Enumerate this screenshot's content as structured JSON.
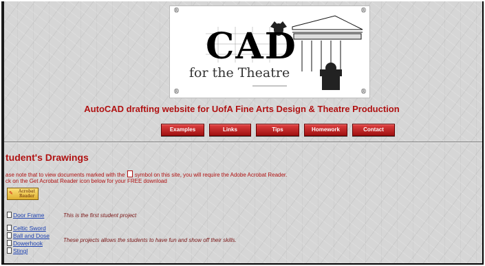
{
  "banner": {
    "logo_letters": "CAD",
    "logo_subtitle": "for the Theatre",
    "reg_mark": "®"
  },
  "tagline": "AutoCAD drafting website for UofA Fine Arts Design & Theatre Production",
  "nav": {
    "items": [
      {
        "label": "Examples"
      },
      {
        "label": "Links"
      },
      {
        "label": "Tips"
      },
      {
        "label": "Homework"
      },
      {
        "label": "Contact"
      }
    ]
  },
  "section": {
    "title": "tudent's Drawings",
    "note_line1_a": "ase note that to view documents marked with the",
    "note_line1_b": "symbol on this site, you will require the Adobe Acrobat Reader.",
    "note_line2": "ck on the Get Acrobat Reader icon below for your FREE download",
    "acrobat_label": "Acrobat Reader"
  },
  "projects": {
    "first": {
      "label": "Door Frame",
      "description": "This is the first student project"
    },
    "group": [
      {
        "label": "Celtic Sword"
      },
      {
        "label": "Ball and Dose"
      },
      {
        "label": "Dowerhook"
      },
      {
        "label": "Stingl"
      }
    ],
    "group_description": "These projects allows the students to have fun and show off their skills."
  },
  "colors": {
    "accent": "#b01111",
    "link": "#1a3fb0",
    "background": "#d6d6d6"
  }
}
